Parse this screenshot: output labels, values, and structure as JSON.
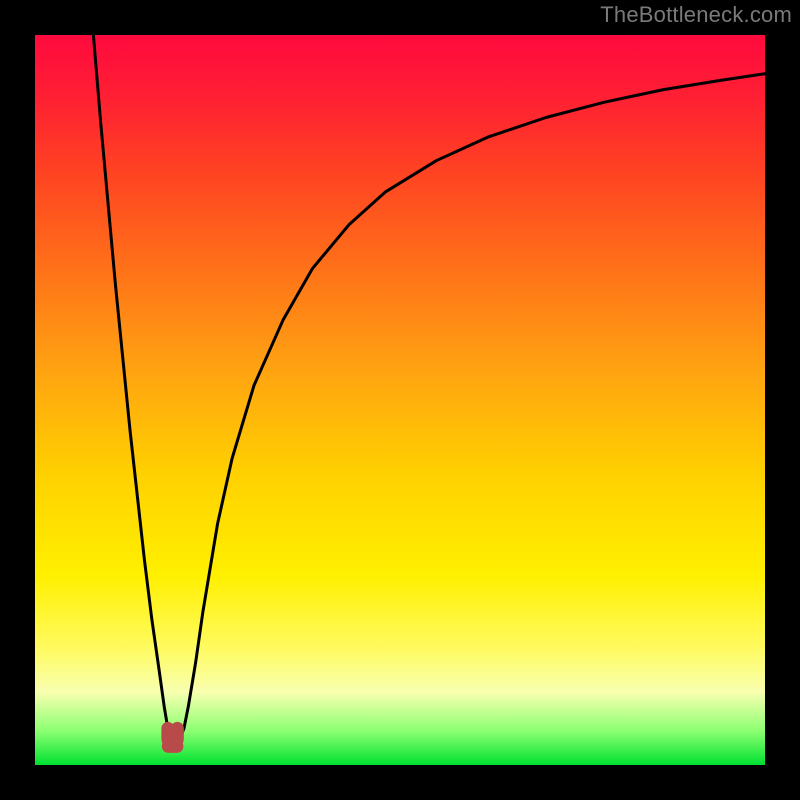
{
  "watermark": "TheBottleneck.com",
  "chart_data": {
    "type": "line",
    "title": "",
    "xlabel": "",
    "ylabel": "",
    "xlim": [
      0,
      100
    ],
    "ylim": [
      0,
      100
    ],
    "grid": false,
    "series": [
      {
        "name": "bottleneck-curve",
        "x": [
          8,
          9,
          10,
          11,
          12,
          13,
          14,
          15,
          16,
          17,
          17.7,
          18.2,
          18.7,
          19.2,
          19.7,
          20.4,
          21,
          22,
          23,
          25,
          27,
          30,
          34,
          38,
          43,
          48,
          55,
          62,
          70,
          78,
          86,
          94,
          100
        ],
        "values": [
          100,
          88,
          77,
          66,
          56,
          46,
          37,
          28,
          20,
          13,
          8,
          5,
          3.2,
          3.0,
          3.2,
          5,
          8,
          14,
          21,
          33,
          42,
          52,
          61,
          68,
          74,
          78.5,
          82.8,
          86,
          88.7,
          90.8,
          92.5,
          93.8,
          94.7
        ]
      }
    ],
    "minimum_marker": {
      "x_range": [
        18.2,
        19.5
      ],
      "y": 3.1,
      "color": "#b94a4a"
    }
  },
  "colors": {
    "curve": "#000000",
    "marker": "#b94a4a",
    "frame": "#000000"
  }
}
